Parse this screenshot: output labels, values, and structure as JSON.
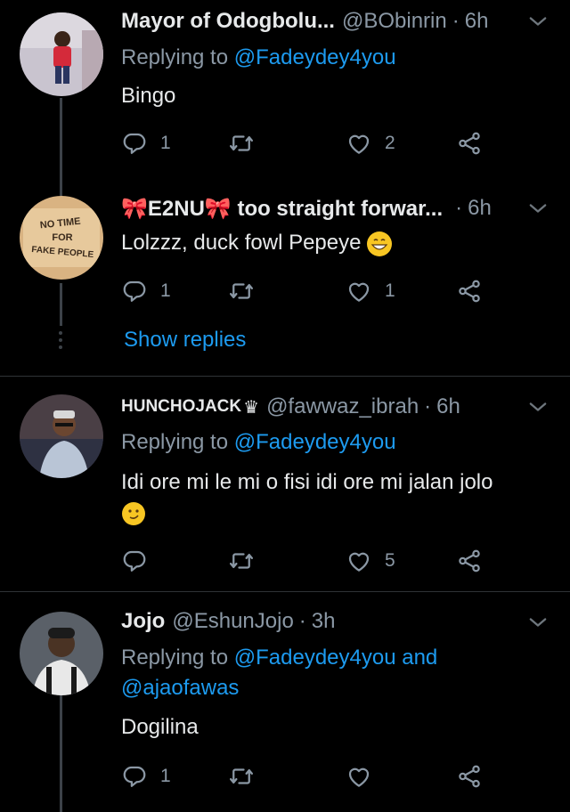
{
  "tweets": [
    {
      "name": "Mayor of Odogbolu...",
      "handle": "@BObinrin",
      "time": "6h",
      "reply_prefix": "Replying to ",
      "reply_to": "@Fadeydey4you",
      "text": "Bingo",
      "replies": "1",
      "retweets": "",
      "likes": "2"
    },
    {
      "name": "🎀E2NU🎀 too straight forwar...",
      "handle": "",
      "time": "6h",
      "text": "Lolzzz, duck fowl Pepeye",
      "replies": "1",
      "retweets": "",
      "likes": "1",
      "show_replies": "Show replies",
      "avatar_text": [
        "NO TIME",
        "FOR",
        "FAKE PEOPLE"
      ]
    },
    {
      "name": "HUNCHOJACK",
      "handle": "@fawwaz_ibrah",
      "time": "6h",
      "reply_prefix": "Replying to ",
      "reply_to": "@Fadeydey4you",
      "text": "Idi ore mi le mi o fisi idi ore mi jalan jolo",
      "replies": "",
      "retweets": "",
      "likes": "5"
    },
    {
      "name": "Jojo",
      "handle": "@EshunJojo",
      "time": "3h",
      "reply_prefix": "Replying to ",
      "reply_to": "@Fadeydey4you",
      "reply_and": " and",
      "reply_to_2": "@ajaofawas",
      "text": "Dogilina",
      "replies": "1",
      "retweets": "",
      "likes": ""
    }
  ],
  "separator": "·",
  "icons": {
    "reply": "reply-icon",
    "retweet": "retweet-icon",
    "like": "heart-icon",
    "share": "share-icon",
    "menu": "chevron-down-icon"
  },
  "colors": {
    "background": "#000000",
    "text": "#e7e9ea",
    "secondary": "#8b98a5",
    "link": "#1d9bf0"
  }
}
